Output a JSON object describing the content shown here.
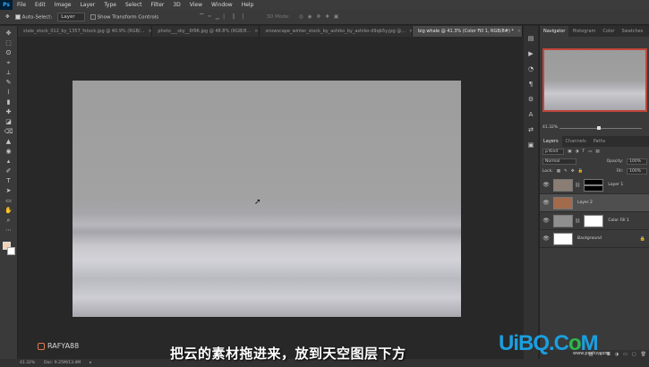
{
  "app": {
    "logo": "Ps",
    "menu": [
      "File",
      "Edit",
      "Image",
      "Layer",
      "Type",
      "Select",
      "Filter",
      "3D",
      "View",
      "Window",
      "Help"
    ]
  },
  "options": {
    "auto_select_label": "Auto-Select:",
    "auto_select_value": "Layer",
    "transform_controls_label": "Show Transform Controls",
    "mode3d_label": "3D Mode:"
  },
  "tabs": [
    {
      "label": "stale_stock_012_by_1357_fstock.jpg @ 40.9% (RGB/...",
      "active": false
    },
    {
      "label": "photo___sky__6f96.jpg @ 48.8% (RGB/8...",
      "active": false
    },
    {
      "label": "snowscape_winter_stock_by_ashiko_by_ashiko-d9qb5y.jpg @...",
      "active": false
    },
    {
      "label": "big whale @ 41.3% (Color Fill 1, RGB/8#) *",
      "active": true
    }
  ],
  "tools": [
    "✥",
    "⬚",
    "ʘ",
    "⌖",
    "⟂",
    "✎",
    "⌇",
    "▮",
    "✚",
    "◪",
    "⌫",
    "▲",
    "◉",
    "▴",
    "✐",
    "T",
    "➤",
    "▭",
    "✋",
    "⌕",
    "⋯"
  ],
  "dock_icons": [
    "▤",
    "▶",
    "◔",
    "¶",
    "⚙",
    "A",
    "⇄",
    "▣"
  ],
  "navigator": {
    "tabs": [
      {
        "label": "Navigator",
        "active": true
      },
      {
        "label": "Histogram",
        "active": false
      },
      {
        "label": "Color",
        "active": false
      },
      {
        "label": "Swatches",
        "active": false
      }
    ],
    "zoom": "41.32%",
    "zoom_fraction": 0.46
  },
  "layers_panel": {
    "tabs": [
      {
        "label": "Layers",
        "active": true
      },
      {
        "label": "Channels",
        "active": false
      },
      {
        "label": "Paths",
        "active": false
      }
    ],
    "filter_kind": "ρ Kind",
    "blend_mode": "Normal",
    "opacity_label": "Opacity:",
    "opacity_value": "100%",
    "lock_label": "Lock:",
    "fill_label": "Fill:",
    "fill_value": "100%",
    "layers": [
      {
        "name": "Layer 1",
        "thumb_color": "#8a7d74",
        "mask": true,
        "selected": false,
        "italic": false,
        "locked": false
      },
      {
        "name": "Layer 2",
        "thumb_color": "#a46a4c",
        "mask": false,
        "selected": true,
        "italic": false,
        "locked": false
      },
      {
        "name": "Color Fill 1",
        "thumb_color": "#8f8f8f",
        "mask": true,
        "selected": false,
        "italic": false,
        "locked": false
      },
      {
        "name": "Background",
        "thumb_color": "#ffffff",
        "mask": false,
        "selected": false,
        "italic": true,
        "locked": true
      }
    ]
  },
  "status": {
    "zoom": "41.32%",
    "doc": "Doc: 9.25M/13.4M"
  },
  "overlay": {
    "watermark": "RAFYA88",
    "subtitle": "把云的素材拖进来，放到天空图层下方",
    "site_logo_prefix": "UiBQ.C",
    "site_logo_o": "o",
    "site_logo_suffix": "M",
    "site_url": "www.psahz.com"
  }
}
